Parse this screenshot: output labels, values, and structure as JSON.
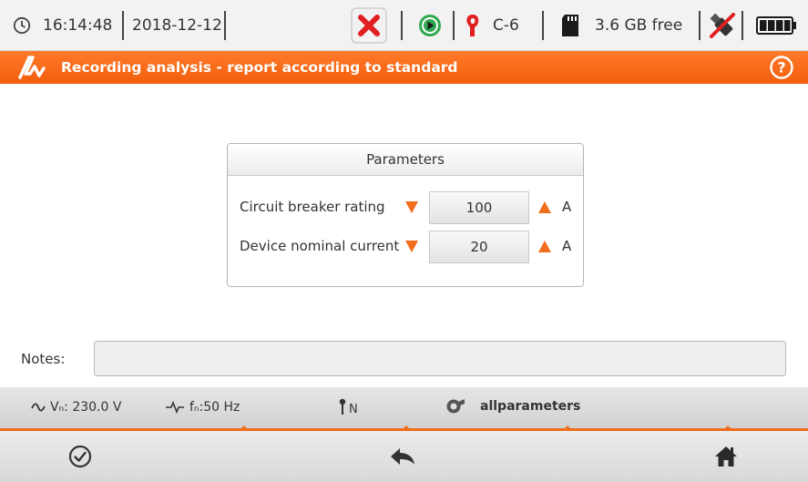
{
  "status_bar": {
    "time": "16:14:48",
    "date": "2018-12-12",
    "clamp_type": "C-6",
    "storage_free": "3.6 GB free",
    "icons": [
      "clock-icon",
      "error-x-icon",
      "recording-play-icon",
      "clamp-icon",
      "sd-card-icon",
      "usb-disconnected-icon",
      "battery-icon"
    ]
  },
  "title_bar": {
    "title": "Recording analysis - report according to standard",
    "logo_icon": "app-logo-icon",
    "help_icon": "help-icon"
  },
  "parameters": {
    "heading": "Parameters",
    "rows": [
      {
        "label": "Circuit breaker rating",
        "value": "100",
        "unit": "A"
      },
      {
        "label": "Device nominal current",
        "value": "20",
        "unit": "A"
      }
    ]
  },
  "notes": {
    "label": "Notes:",
    "value": ""
  },
  "info_bar": {
    "voltage": "Vₙ: 230.0 V",
    "frequency": "fₙ:50 Hz",
    "ground_mark": "N",
    "config_name": "allparameters"
  },
  "bottom_bar": {
    "buttons": [
      "confirm-icon",
      "back-icon",
      "home-icon"
    ]
  },
  "colors": {
    "accent": "#f26d1c",
    "header_gradient_top": "#ff7a2a",
    "error_red": "#e02020",
    "play_green": "#2fa84f"
  }
}
